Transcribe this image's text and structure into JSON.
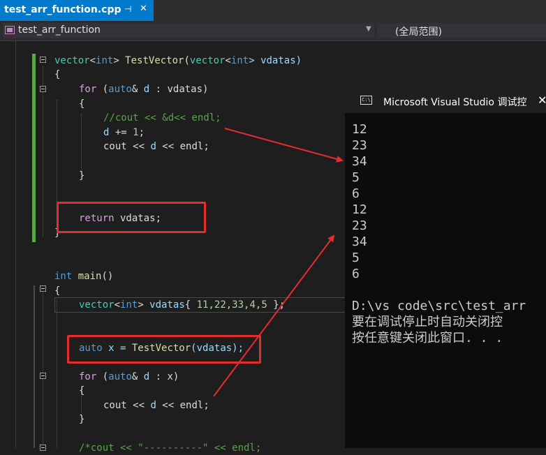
{
  "tab": {
    "title": "test_arr_function.cpp",
    "pin": "⊣",
    "close": "✕"
  },
  "navbar": {
    "left": "test_arr_function",
    "right": "(全局范围)"
  },
  "code": {
    "l1": {
      "a": "vector",
      "b": "<",
      "c": "int",
      "d": "> ",
      "e": "TestVector",
      "f": "(",
      "g": "vector",
      "h": "<",
      "i": "int",
      "j": "> vdatas)"
    },
    "l2": "{",
    "l3": {
      "a": "for",
      "b": " (",
      "c": "auto",
      "d": "& ",
      "e": "d",
      "f": " : vdatas)"
    },
    "l4": "{",
    "l5": "//cout << &d<< endl;",
    "l6": {
      "a": "d",
      "b": " += ",
      "c": "1",
      "d": ";"
    },
    "l7": {
      "a": "cout",
      "b": " << ",
      "c": "d",
      "d": " << ",
      "e": "endl",
      "f": ";"
    },
    "l8": "}",
    "l9": {
      "a": "return",
      "b": " vdatas;"
    },
    "l10": "}",
    "l11": {
      "a": "int",
      "b": " ",
      "c": "main",
      "d": "()"
    },
    "l12": "{",
    "l13": {
      "a": "vector",
      "b": "<",
      "c": "int",
      "d": "> ",
      "e": "vdatas",
      "f": "{ ",
      "g": "11,22,33,4,5",
      "h": " };"
    },
    "l14": {
      "a": "auto",
      "b": " x = ",
      "c": "TestVector",
      "d": "(vdatas);"
    },
    "l15": {
      "a": "for",
      "b": " (",
      "c": "auto",
      "d": "& ",
      "e": "d",
      "f": " : x)"
    },
    "l16": "{",
    "l17": {
      "a": "cout",
      "b": " << ",
      "c": "d",
      "d": " << ",
      "e": "endl",
      "f": ";"
    },
    "l18": "}",
    "l19": "/*cout << \"----------\" << endl;"
  },
  "console": {
    "title": "Microsoft Visual Studio 调试控",
    "icon": "C:\\",
    "close": "✕",
    "lines": [
      "12",
      "23",
      "34",
      "5",
      "6",
      "12",
      "23",
      "34",
      "5",
      "6",
      "",
      "D:\\vs code\\src\\test_arr",
      "要在调试停止时自动关闭控",
      "按任意键关闭此窗口. . ."
    ]
  }
}
